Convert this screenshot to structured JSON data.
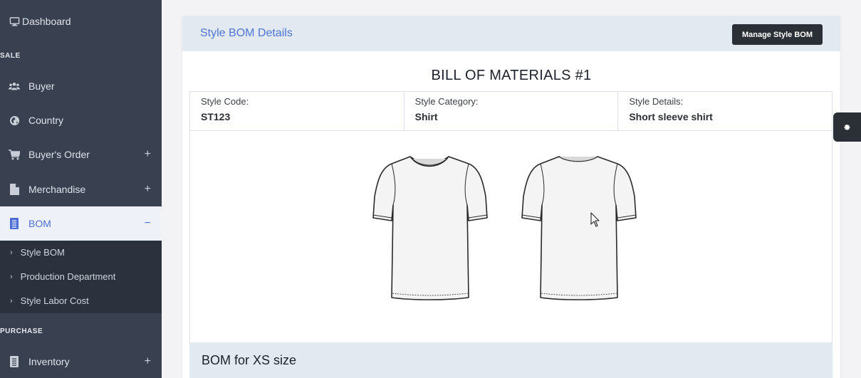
{
  "sidebar": {
    "items": [
      {
        "label": "Dashboard",
        "icon": "monitor-icon"
      },
      {
        "label": "Buyer",
        "icon": "users-icon"
      },
      {
        "label": "Country",
        "icon": "globe-icon"
      },
      {
        "label": "Buyer's Order",
        "icon": "cart-icon",
        "expand": "+"
      },
      {
        "label": "Merchandise",
        "icon": "file-icon",
        "expand": "+"
      },
      {
        "label": "BOM",
        "icon": "receipt-icon",
        "expand": "−"
      },
      {
        "label": "Inventory",
        "icon": "receipt-icon",
        "expand": "+"
      }
    ],
    "sections": [
      "SALE",
      "PURCHASE"
    ],
    "bom_submenu": [
      "Style BOM",
      "Production Department",
      "Style Labor Cost"
    ],
    "submenu_chevron": "›"
  },
  "card": {
    "title": "Style BOM Details",
    "manage_button": "Manage Style BOM",
    "bom_title": "BILL OF MATERIALS #1",
    "info": [
      {
        "label": "Style Code:",
        "value": "ST123"
      },
      {
        "label": "Style Category:",
        "value": "Shirt"
      },
      {
        "label": "Style Details:",
        "value": "Short sleeve shirt"
      }
    ],
    "bom_size_title": "BOM for XS size"
  },
  "colors": {
    "sidebar_bg": "#394150",
    "active_accent": "#4e6fd6",
    "header_bg": "#e3e9f0",
    "dark_button": "#2b2f36"
  }
}
